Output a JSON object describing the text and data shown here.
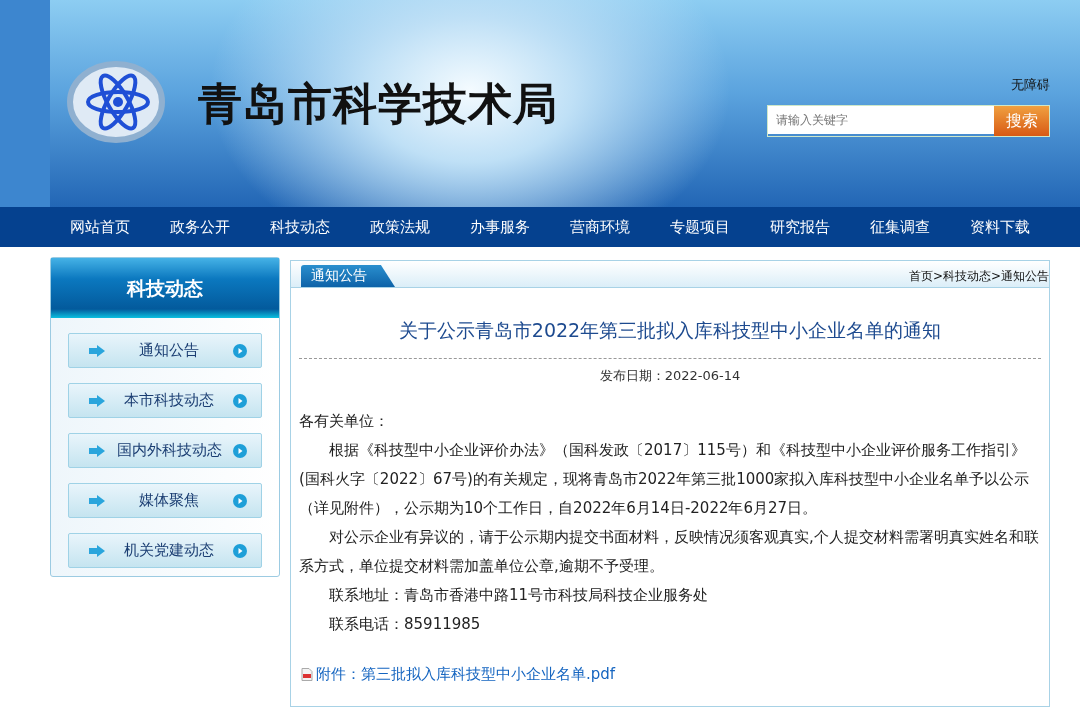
{
  "header": {
    "site_title": "青岛市科学技术局",
    "accessibility_link": "无障碍",
    "search": {
      "placeholder": "请输入关键字",
      "button": "搜索"
    }
  },
  "nav": [
    {
      "label": "网站首页",
      "selected": false
    },
    {
      "label": "政务公开",
      "selected": false
    },
    {
      "label": "科技动态",
      "selected": false
    },
    {
      "label": "政策法规",
      "selected": false
    },
    {
      "label": "办事服务",
      "selected": false
    },
    {
      "label": "营商环境",
      "selected": false
    },
    {
      "label": "专题项目",
      "selected": false
    },
    {
      "label": "研究报告",
      "selected": false
    },
    {
      "label": "征集调查",
      "selected": false
    },
    {
      "label": "资料下载",
      "selected": false
    }
  ],
  "sidebar": {
    "title": "科技动态",
    "items": [
      {
        "label": "通知公告"
      },
      {
        "label": "本市科技动态"
      },
      {
        "label": "国内外科技动态"
      },
      {
        "label": "媒体聚焦"
      },
      {
        "label": "机关党建动态"
      }
    ]
  },
  "content": {
    "tab": "通知公告",
    "breadcrumb": "首页>科技动态>通知公告",
    "title": "关于公示青岛市2022年第三批拟入库科技型中小企业名单的通知",
    "date": "发布日期：2022-06-14",
    "paragraphs": [
      {
        "text": "各有关单位：",
        "indent": false
      },
      {
        "text": "根据《科技型中小企业评价办法》（国科发政〔2017〕115号）和《科技型中小企业评价服务工作指引》(国科火字〔2022〕67号)的有关规定，现将青岛市2022年第三批1000家拟入库科技型中小企业名单予以公示（详见附件），公示期为10个工作日，自2022年6月14日-2022年6月27日。",
        "indent": true
      },
      {
        "text": "对公示企业有异议的，请于公示期内提交书面材料，反映情况须客观真实,个人提交材料需署明真实姓名和联系方式，单位提交材料需加盖单位公章,逾期不予受理。",
        "indent": true
      },
      {
        "text": "联系地址：青岛市香港中路11号市科技局科技企业服务处",
        "indent": true
      },
      {
        "text": "联系电话：85911985",
        "indent": true
      }
    ],
    "attachment": "附件：第三批拟入库科技型中小企业名单.pdf"
  }
}
